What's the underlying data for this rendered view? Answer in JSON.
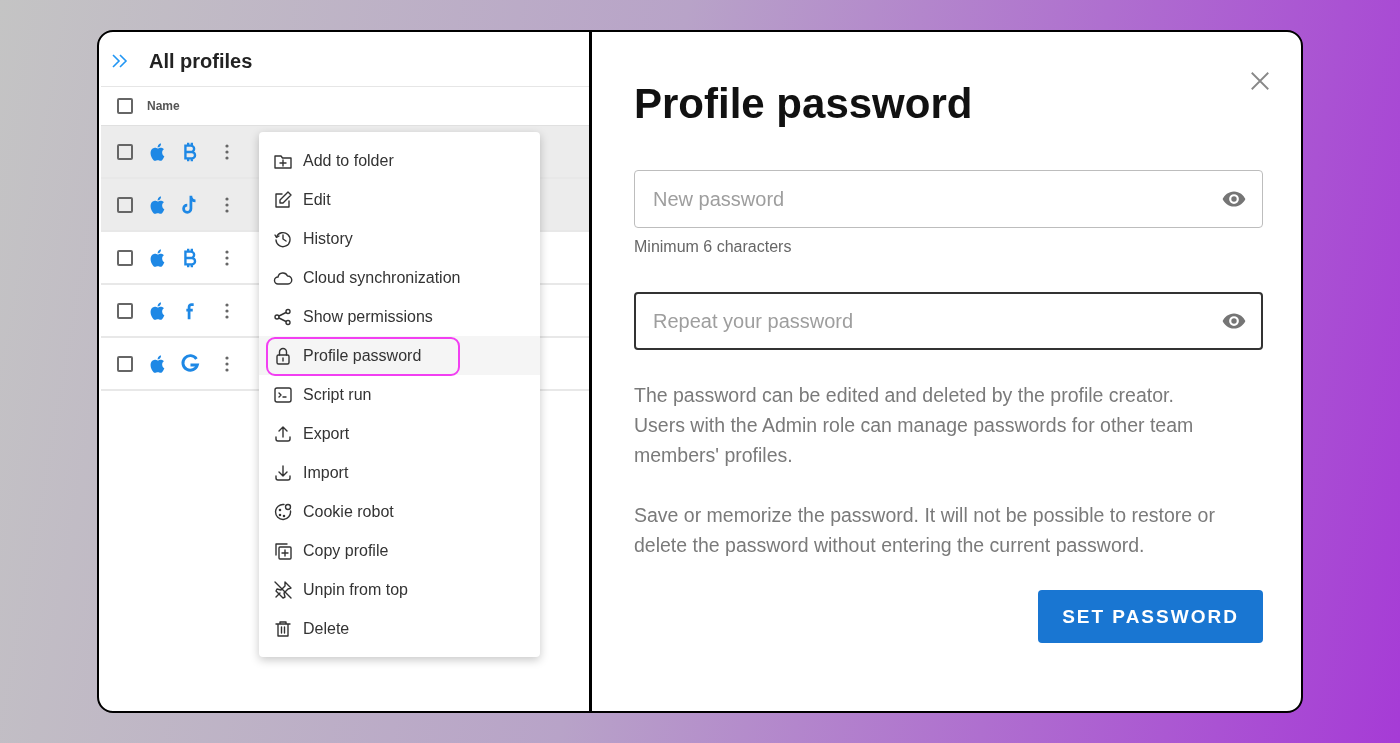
{
  "left_panel": {
    "title": "All profiles",
    "table": {
      "columns": [
        "Name"
      ],
      "header_checked": false,
      "rows": [
        {
          "checked": false,
          "highlighted": true
        },
        {
          "checked": false,
          "highlighted": true
        },
        {
          "checked": false,
          "highlighted": false
        },
        {
          "checked": false,
          "highlighted": false
        },
        {
          "checked": false,
          "highlighted": false
        }
      ]
    }
  },
  "context_menu": {
    "items": [
      {
        "label": "Add to folder",
        "selected": false
      },
      {
        "label": "Edit",
        "selected": false
      },
      {
        "label": "History",
        "selected": false
      },
      {
        "label": "Cloud synchronization",
        "selected": false
      },
      {
        "label": "Show permissions",
        "selected": false
      },
      {
        "label": "Profile password",
        "selected": true
      },
      {
        "label": "Script run",
        "selected": false
      },
      {
        "label": "Export",
        "selected": false
      },
      {
        "label": "Import",
        "selected": false
      },
      {
        "label": "Cookie robot",
        "selected": false
      },
      {
        "label": "Copy profile",
        "selected": false
      },
      {
        "label": "Unpin from top",
        "selected": false
      },
      {
        "label": "Delete",
        "selected": false
      }
    ]
  },
  "dialog": {
    "title": "Profile password",
    "fields": [
      {
        "placeholder": "New password",
        "helper": "Minimum 6 characters",
        "focused": false
      },
      {
        "placeholder": "Repeat your password",
        "focused": true
      }
    ],
    "paragraphs": [
      "The password can be edited and deleted by the profile creator. Users with the Admin role can manage passwords for other team members' profiles.",
      "Save or memorize the password. It will not be possible to restore or delete the password without entering the current password."
    ],
    "button": "SET PASSWORD"
  }
}
